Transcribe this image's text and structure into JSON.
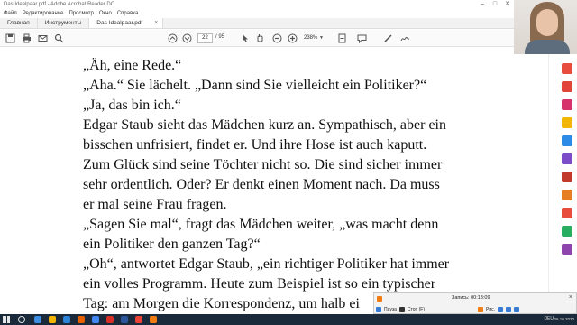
{
  "window": {
    "title": "Das Idealpaar.pdf - Adobe Acrobat Reader DC",
    "controls": [
      "–",
      "□",
      "✕"
    ]
  },
  "menu": [
    "Файл",
    "Редактирование",
    "Просмотр",
    "Окно",
    "Справка"
  ],
  "tabs": {
    "home": "Главная",
    "tools": "Инструменты",
    "document": "Das Idealpaar.pdf",
    "close": "×"
  },
  "toolbar": {
    "current_page": "22",
    "total_pages": "/ 95",
    "zoom": "238%"
  },
  "document": {
    "lines": [
      "„Äh, eine Rede.“",
      "„Aha.“ Sie lächelt. „Dann sind Sie vielleicht ein Politiker?“",
      "„Ja, das bin ich.“",
      "Edgar Staub sieht das Mädchen kurz an. Sympathisch, aber ein",
      "bisschen unfrisiert, findet er. Und ihre Hose ist auch kaputt.",
      "Zum Glück sind seine Töchter nicht so. Die sind sicher immer",
      "sehr ordentlich. Oder? Er denkt einen Moment nach. Da muss",
      "er mal seine Frau fragen.",
      "„Sagen Sie mal“, fragt das Mädchen weiter, „was macht denn",
      "ein Politiker den ganzen Tag?“",
      "„Oh“, antwortet Edgar Staub, „ein richtiger Politiker hat immer",
      "ein volles Programm. Heute zum Beispiel ist so ein typischer",
      "Tag: am Morgen die Korrespondenz, um halb ei"
    ]
  },
  "recorder": {
    "timer": "Запись: 00:13:09",
    "pause": "Пауза",
    "stop": "Стоп (F)",
    "draw": "Рис."
  },
  "taskbar": {
    "lang": "DEU",
    "date": "26.10.2020"
  },
  "colors": {
    "taskbar": "#1b2a3a",
    "recorder_accent": "#f07c12"
  }
}
